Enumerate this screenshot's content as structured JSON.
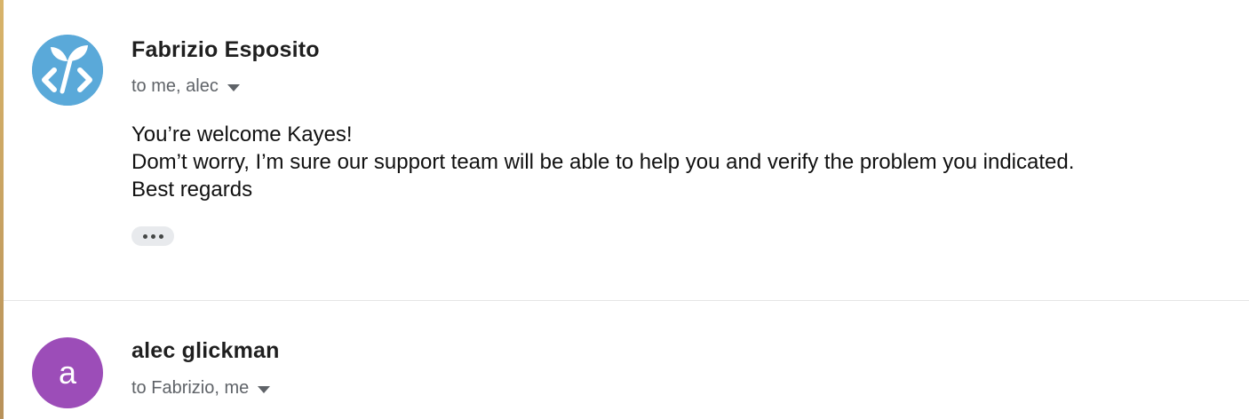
{
  "messages": [
    {
      "sender": "Fabrizio Esposito",
      "recipients": "to me, alec",
      "avatar": {
        "icon": "developer-code-sprout-logo",
        "background": "#5aa9d9"
      },
      "body": [
        "You’re welcome Kayes!",
        "Dom’t worry, I’m sure our support team will be able to help you and verify the problem you indicated.",
        "Best regards"
      ],
      "collapsed_content_icon": "more-horizontal-icon"
    },
    {
      "sender": "alec glickman",
      "recipients": "to Fabrizio, me",
      "avatar": {
        "letter": "a",
        "background": "#9c4db8"
      }
    }
  ],
  "colors": {
    "divider": "#e5e5e5",
    "secondary_text": "#5f6368",
    "left_edge": "#c9a265"
  }
}
